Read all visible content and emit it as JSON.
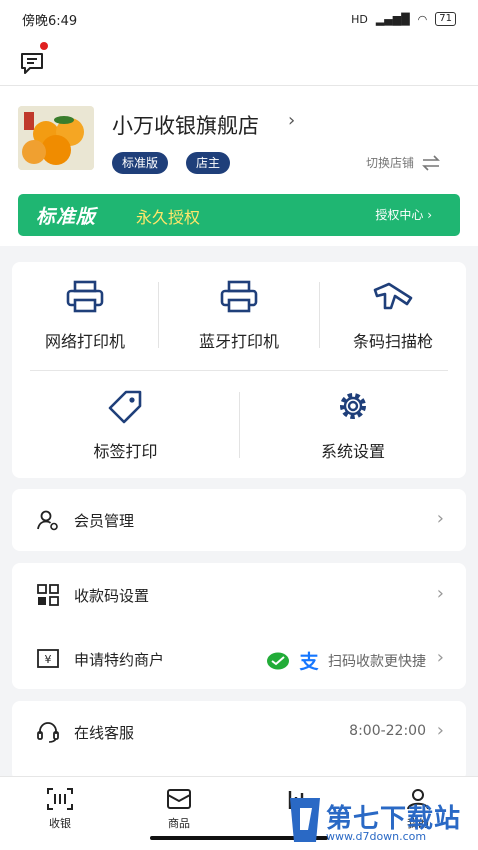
{
  "status_bar": {
    "time": "傍晚6:49",
    "network": "HD",
    "battery": "71"
  },
  "store": {
    "name": "小万收银旗舰店",
    "tags": [
      "标准版",
      "店主"
    ],
    "switch_label": "切换店铺"
  },
  "license": {
    "title": "标准版",
    "subtitle": "永久授权",
    "center": "授权中心"
  },
  "tools": [
    {
      "label": "网络打印机",
      "icon": "printer-icon"
    },
    {
      "label": "蓝牙打印机",
      "icon": "bluetooth-printer-icon"
    },
    {
      "label": "条码扫描枪",
      "icon": "barcode-scanner-icon"
    },
    {
      "label": "标签打印",
      "icon": "tag-icon"
    },
    {
      "label": "系统设置",
      "icon": "gear-icon"
    }
  ],
  "menu": {
    "member": "会员管理",
    "qrcode": "收款码设置",
    "merchant": "申请特约商户",
    "merchant_hint": "扫码收款更快捷",
    "service": "在线客服",
    "service_hours": "8:00-22:00"
  },
  "tabs": [
    {
      "label": "收银",
      "icon": "scan-icon"
    },
    {
      "label": "商品",
      "icon": "box-icon"
    },
    {
      "label": "",
      "icon": "chart-icon"
    },
    {
      "label": "我的",
      "icon": "user-icon"
    }
  ],
  "watermark": {
    "text": "第七下载站",
    "url": "www.d7down.com"
  },
  "colors": {
    "brand_navy": "#1f3f7a",
    "license_green": "#1fb672",
    "license_yellow": "#ffe66a",
    "watermark_blue": "#2a69c5"
  }
}
